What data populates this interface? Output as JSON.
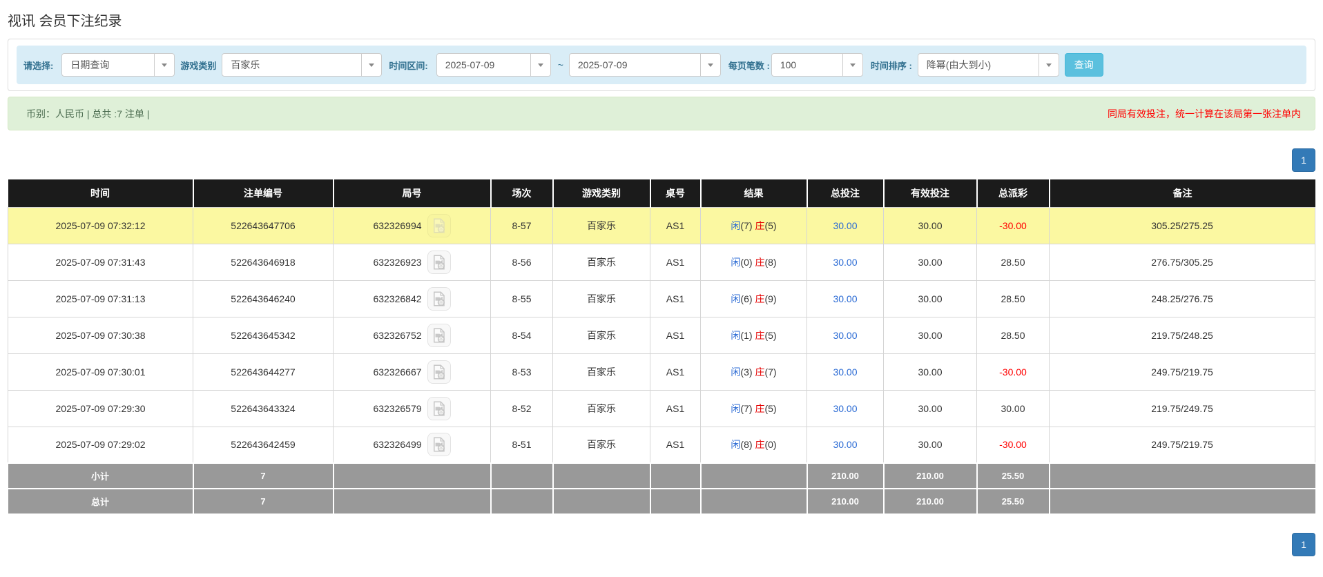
{
  "title": "视讯 会员下注纪录",
  "filters": {
    "choose_label": "请选择:",
    "choose_value": "日期查询",
    "game_label": "游戏类别",
    "game_value": "百家乐",
    "range_label": "时间区间:",
    "date_from": "2025-07-09",
    "tilde": "~",
    "date_to": "2025-07-09",
    "per_page_label": "每页笔数 :",
    "per_page_value": "100",
    "sort_label": "时间排序 :",
    "sort_value": "降幂(由大到小)",
    "search_button": "查询"
  },
  "info_bar": {
    "left": "币别：人民币 | 总共 :7 注单 |",
    "right": "同局有效投注，统一计算在该局第一张注单内"
  },
  "pagination": {
    "page": "1"
  },
  "table": {
    "headers": [
      "时间",
      "注单编号",
      "局号",
      "场次",
      "游戏类别",
      "桌号",
      "结果",
      "总投注",
      "有效投注",
      "总派彩",
      "备注"
    ],
    "result_labels": {
      "player": "闲",
      "banker": "庄"
    },
    "rows": [
      {
        "time": "2025-07-09 07:32:12",
        "bet_no": "522643647706",
        "round_no": "632326994",
        "session": "8-57",
        "game": "百家乐",
        "table": "AS1",
        "player": "7",
        "banker": "5",
        "total_bet": "30.00",
        "valid_bet": "30.00",
        "payout": "-30.00",
        "remark": "305.25/275.25",
        "highlighted": true
      },
      {
        "time": "2025-07-09 07:31:43",
        "bet_no": "522643646918",
        "round_no": "632326923",
        "session": "8-56",
        "game": "百家乐",
        "table": "AS1",
        "player": "0",
        "banker": "8",
        "total_bet": "30.00",
        "valid_bet": "30.00",
        "payout": "28.50",
        "remark": "276.75/305.25",
        "highlighted": false
      },
      {
        "time": "2025-07-09 07:31:13",
        "bet_no": "522643646240",
        "round_no": "632326842",
        "session": "8-55",
        "game": "百家乐",
        "table": "AS1",
        "player": "6",
        "banker": "9",
        "total_bet": "30.00",
        "valid_bet": "30.00",
        "payout": "28.50",
        "remark": "248.25/276.75",
        "highlighted": false
      },
      {
        "time": "2025-07-09 07:30:38",
        "bet_no": "522643645342",
        "round_no": "632326752",
        "session": "8-54",
        "game": "百家乐",
        "table": "AS1",
        "player": "1",
        "banker": "5",
        "total_bet": "30.00",
        "valid_bet": "30.00",
        "payout": "28.50",
        "remark": "219.75/248.25",
        "highlighted": false
      },
      {
        "time": "2025-07-09 07:30:01",
        "bet_no": "522643644277",
        "round_no": "632326667",
        "session": "8-53",
        "game": "百家乐",
        "table": "AS1",
        "player": "3",
        "banker": "7",
        "total_bet": "30.00",
        "valid_bet": "30.00",
        "payout": "-30.00",
        "remark": "249.75/219.75",
        "highlighted": false
      },
      {
        "time": "2025-07-09 07:29:30",
        "bet_no": "522643643324",
        "round_no": "632326579",
        "session": "8-52",
        "game": "百家乐",
        "table": "AS1",
        "player": "7",
        "banker": "5",
        "total_bet": "30.00",
        "valid_bet": "30.00",
        "payout": "30.00",
        "remark": "219.75/249.75",
        "highlighted": false
      },
      {
        "time": "2025-07-09 07:29:02",
        "bet_no": "522643642459",
        "round_no": "632326499",
        "session": "8-51",
        "game": "百家乐",
        "table": "AS1",
        "player": "8",
        "banker": "0",
        "total_bet": "30.00",
        "valid_bet": "30.00",
        "payout": "-30.00",
        "remark": "249.75/219.75",
        "highlighted": false
      }
    ],
    "subtotal": {
      "label": "小计",
      "count": "7",
      "total_bet": "210.00",
      "valid_bet": "210.00",
      "payout": "25.50"
    },
    "grand_total": {
      "label": "总计",
      "count": "7",
      "total_bet": "210.00",
      "valid_bet": "210.00",
      "payout": "25.50"
    }
  },
  "icons": {
    "round_replay": "video-record-icon",
    "dropdown_arrow": "chevron-down-icon"
  },
  "colors": {
    "link_blue": "#2a6ad4",
    "loss_red": "#ff0000",
    "banker_red": "#e40000",
    "highlight_yellow": "#fbf8a1",
    "header_black": "#1b1b1b",
    "summary_gray": "#999999",
    "search_button_blue": "#5bc0de",
    "pagination_blue": "#337ab7",
    "filter_bar_blue": "#d9edf7",
    "info_bar_green": "#dff0d8"
  }
}
